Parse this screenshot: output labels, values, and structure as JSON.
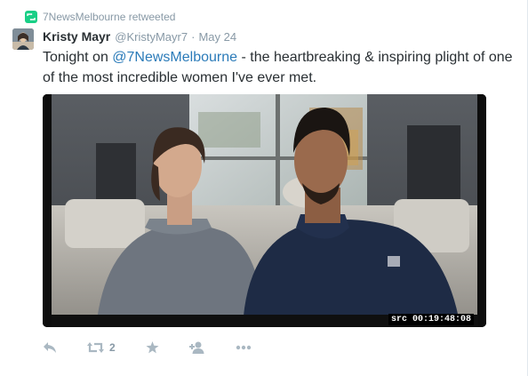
{
  "retweet": {
    "text": "7NewsMelbourne retweeted"
  },
  "tweet": {
    "fullname": "Kristy Mayr",
    "username": "@KristyMayr7",
    "separator": "·",
    "timestamp": "May 24",
    "text_before": "Tonight on ",
    "mention": "@7NewsMelbourne",
    "text_after": " - the heartbreaking & inspiring plight of one of the most incredible women I've ever met."
  },
  "media": {
    "timecode": "src 00:19:48:08"
  },
  "actions": {
    "retweet_count": "2"
  },
  "colors": {
    "retweet_green": "#19cf86",
    "link_blue": "#2b7bb9",
    "muted_gray": "#8899a6",
    "action_gray": "#aab8c2"
  },
  "icons": {
    "retweeted_badge": "retweet-icon",
    "reply": "reply-icon",
    "retweet": "retweet-icon",
    "favorite": "star-icon",
    "follow": "add-user-icon",
    "more": "more-icon"
  }
}
